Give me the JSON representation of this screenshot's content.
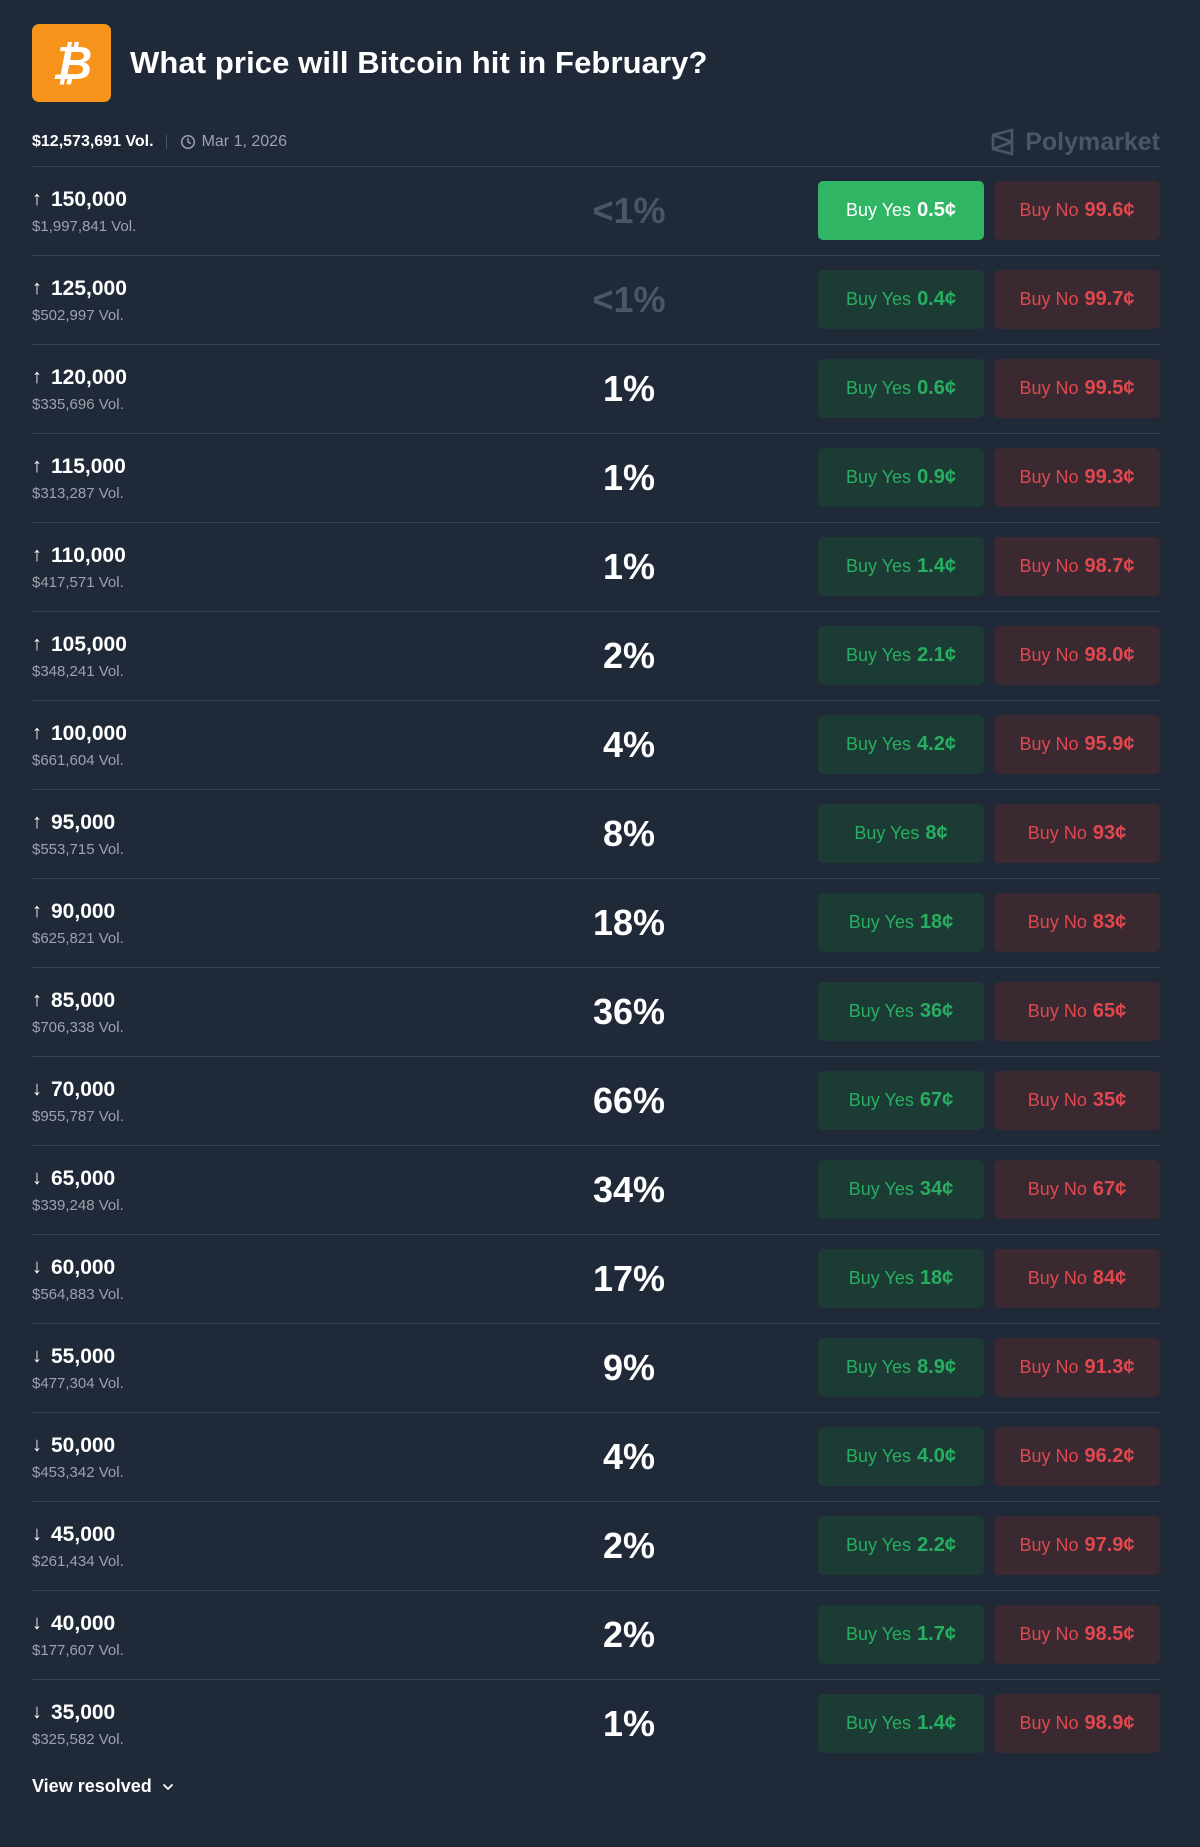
{
  "market": {
    "title": "What price will Bitcoin hit in February?",
    "volume": "$12,573,691 Vol.",
    "end_date": "Mar 1, 2026",
    "brand": "Polymarket",
    "logo_icon": "bitcoin-icon",
    "logo_color": "#f7931a"
  },
  "colors": {
    "background": "#1f2937",
    "yes_text": "#27ae60",
    "yes_active_bg": "#2fb564",
    "no_text": "#e0484f"
  },
  "buttons": {
    "yes_label": "Buy Yes",
    "no_label": "Buy No"
  },
  "rows": [
    {
      "direction": "up",
      "arrow": "↑",
      "label": "150,000",
      "volume": "$1,997,841 Vol.",
      "chance": "<1%",
      "dim": true,
      "yes_price": "0.5¢",
      "no_price": "99.6¢",
      "yes_active": true
    },
    {
      "direction": "up",
      "arrow": "↑",
      "label": "125,000",
      "volume": "$502,997 Vol.",
      "chance": "<1%",
      "dim": true,
      "yes_price": "0.4¢",
      "no_price": "99.7¢"
    },
    {
      "direction": "up",
      "arrow": "↑",
      "label": "120,000",
      "volume": "$335,696 Vol.",
      "chance": "1%",
      "yes_price": "0.6¢",
      "no_price": "99.5¢"
    },
    {
      "direction": "up",
      "arrow": "↑",
      "label": "115,000",
      "volume": "$313,287 Vol.",
      "chance": "1%",
      "yes_price": "0.9¢",
      "no_price": "99.3¢"
    },
    {
      "direction": "up",
      "arrow": "↑",
      "label": "110,000",
      "volume": "$417,571 Vol.",
      "chance": "1%",
      "yes_price": "1.4¢",
      "no_price": "98.7¢"
    },
    {
      "direction": "up",
      "arrow": "↑",
      "label": "105,000",
      "volume": "$348,241 Vol.",
      "chance": "2%",
      "yes_price": "2.1¢",
      "no_price": "98.0¢"
    },
    {
      "direction": "up",
      "arrow": "↑",
      "label": "100,000",
      "volume": "$661,604 Vol.",
      "chance": "4%",
      "yes_price": "4.2¢",
      "no_price": "95.9¢"
    },
    {
      "direction": "up",
      "arrow": "↑",
      "label": "95,000",
      "volume": "$553,715 Vol.",
      "chance": "8%",
      "yes_price": "8¢",
      "no_price": "93¢"
    },
    {
      "direction": "up",
      "arrow": "↑",
      "label": "90,000",
      "volume": "$625,821 Vol.",
      "chance": "18%",
      "yes_price": "18¢",
      "no_price": "83¢"
    },
    {
      "direction": "up",
      "arrow": "↑",
      "label": "85,000",
      "volume": "$706,338 Vol.",
      "chance": "36%",
      "yes_price": "36¢",
      "no_price": "65¢"
    },
    {
      "direction": "down",
      "arrow": "↓",
      "label": "70,000",
      "volume": "$955,787 Vol.",
      "chance": "66%",
      "yes_price": "67¢",
      "no_price": "35¢"
    },
    {
      "direction": "down",
      "arrow": "↓",
      "label": "65,000",
      "volume": "$339,248 Vol.",
      "chance": "34%",
      "yes_price": "34¢",
      "no_price": "67¢"
    },
    {
      "direction": "down",
      "arrow": "↓",
      "label": "60,000",
      "volume": "$564,883 Vol.",
      "chance": "17%",
      "yes_price": "18¢",
      "no_price": "84¢"
    },
    {
      "direction": "down",
      "arrow": "↓",
      "label": "55,000",
      "volume": "$477,304 Vol.",
      "chance": "9%",
      "yes_price": "8.9¢",
      "no_price": "91.3¢"
    },
    {
      "direction": "down",
      "arrow": "↓",
      "label": "50,000",
      "volume": "$453,342 Vol.",
      "chance": "4%",
      "yes_price": "4.0¢",
      "no_price": "96.2¢"
    },
    {
      "direction": "down",
      "arrow": "↓",
      "label": "45,000",
      "volume": "$261,434 Vol.",
      "chance": "2%",
      "yes_price": "2.2¢",
      "no_price": "97.9¢"
    },
    {
      "direction": "down",
      "arrow": "↓",
      "label": "40,000",
      "volume": "$177,607 Vol.",
      "chance": "2%",
      "yes_price": "1.7¢",
      "no_price": "98.5¢"
    },
    {
      "direction": "down",
      "arrow": "↓",
      "label": "35,000",
      "volume": "$325,582 Vol.",
      "chance": "1%",
      "yes_price": "1.4¢",
      "no_price": "98.9¢"
    }
  ],
  "footer": {
    "view_resolved": "View resolved",
    "icon": "chevron-down-icon"
  }
}
